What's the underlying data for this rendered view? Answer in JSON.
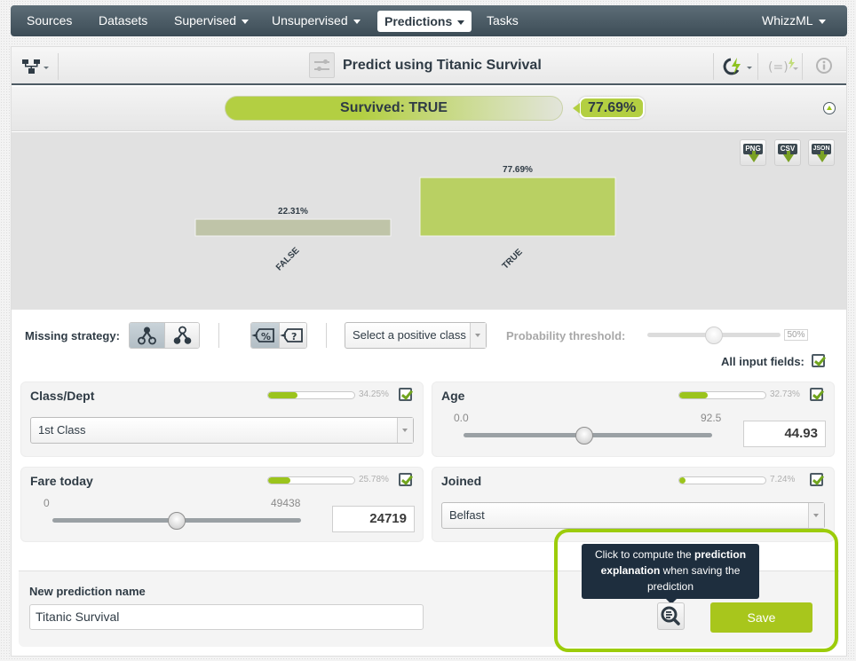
{
  "nav": {
    "items": [
      {
        "label": "Sources",
        "dropdown": false
      },
      {
        "label": "Datasets",
        "dropdown": false
      },
      {
        "label": "Supervised",
        "dropdown": true
      },
      {
        "label": "Unsupervised",
        "dropdown": true
      },
      {
        "label": "Predictions",
        "dropdown": true,
        "active": true
      },
      {
        "label": "Tasks",
        "dropdown": false
      }
    ],
    "right": {
      "label": "WhizzML",
      "dropdown": true
    }
  },
  "toolbar": {
    "title": "Predict using Titanic Survival",
    "left_icon": "model-tree-icon",
    "right_icons": [
      "lightning-cycle-icon",
      "formula-lightning-icon",
      "info-icon"
    ]
  },
  "result": {
    "prediction_label": "Survived: TRUE",
    "confidence": "77.69%",
    "collapse_icon": "collapse-up-icon"
  },
  "chart_data": {
    "type": "bar",
    "title": "",
    "xlabel": "",
    "ylabel": "",
    "categories": [
      "FALSE",
      "TRUE"
    ],
    "values": [
      22.31,
      77.69
    ],
    "value_labels": [
      "22.31%",
      "77.69%"
    ],
    "colors": [
      "#bfc4a8",
      "#b9d063"
    ],
    "ylim": [
      0,
      100
    ],
    "grid": false
  },
  "downloads": [
    {
      "label": "PNG"
    },
    {
      "label": "CSV"
    },
    {
      "label": "JSON"
    }
  ],
  "controls": {
    "missing_strategy_label": "Missing strategy:",
    "positive_class_placeholder": "Select a positive class",
    "threshold_label": "Probability threshold:",
    "threshold_value": "50%",
    "threshold_fraction": 0.5,
    "all_fields_label": "All input fields:",
    "all_fields_checked": true
  },
  "fields": [
    {
      "name": "Class/Dept",
      "importance": "34.25%",
      "importance_value": 34.25,
      "type": "select",
      "value": "1st Class",
      "checked": true
    },
    {
      "name": "Age",
      "importance": "32.73%",
      "importance_value": 32.73,
      "type": "numeric",
      "min": "0.0",
      "max": "92.5",
      "value": "44.93",
      "fraction": 0.486,
      "checked": true
    },
    {
      "name": "Fare today",
      "importance": "25.78%",
      "importance_value": 25.78,
      "type": "numeric",
      "min": "0",
      "max": "49438",
      "value": "24719",
      "fraction": 0.5,
      "checked": true
    },
    {
      "name": "Joined",
      "importance": "7.24%",
      "importance_value": 7.24,
      "type": "select",
      "value": "Belfast",
      "checked": true
    }
  ],
  "save": {
    "name_label": "New prediction name",
    "name_value": "Titanic Survival",
    "tooltip_pre": "Click to compute the ",
    "tooltip_bold1": "prediction",
    "tooltip_bold2": "explanation",
    "tooltip_post": " when saving the prediction",
    "save_label": "Save"
  }
}
